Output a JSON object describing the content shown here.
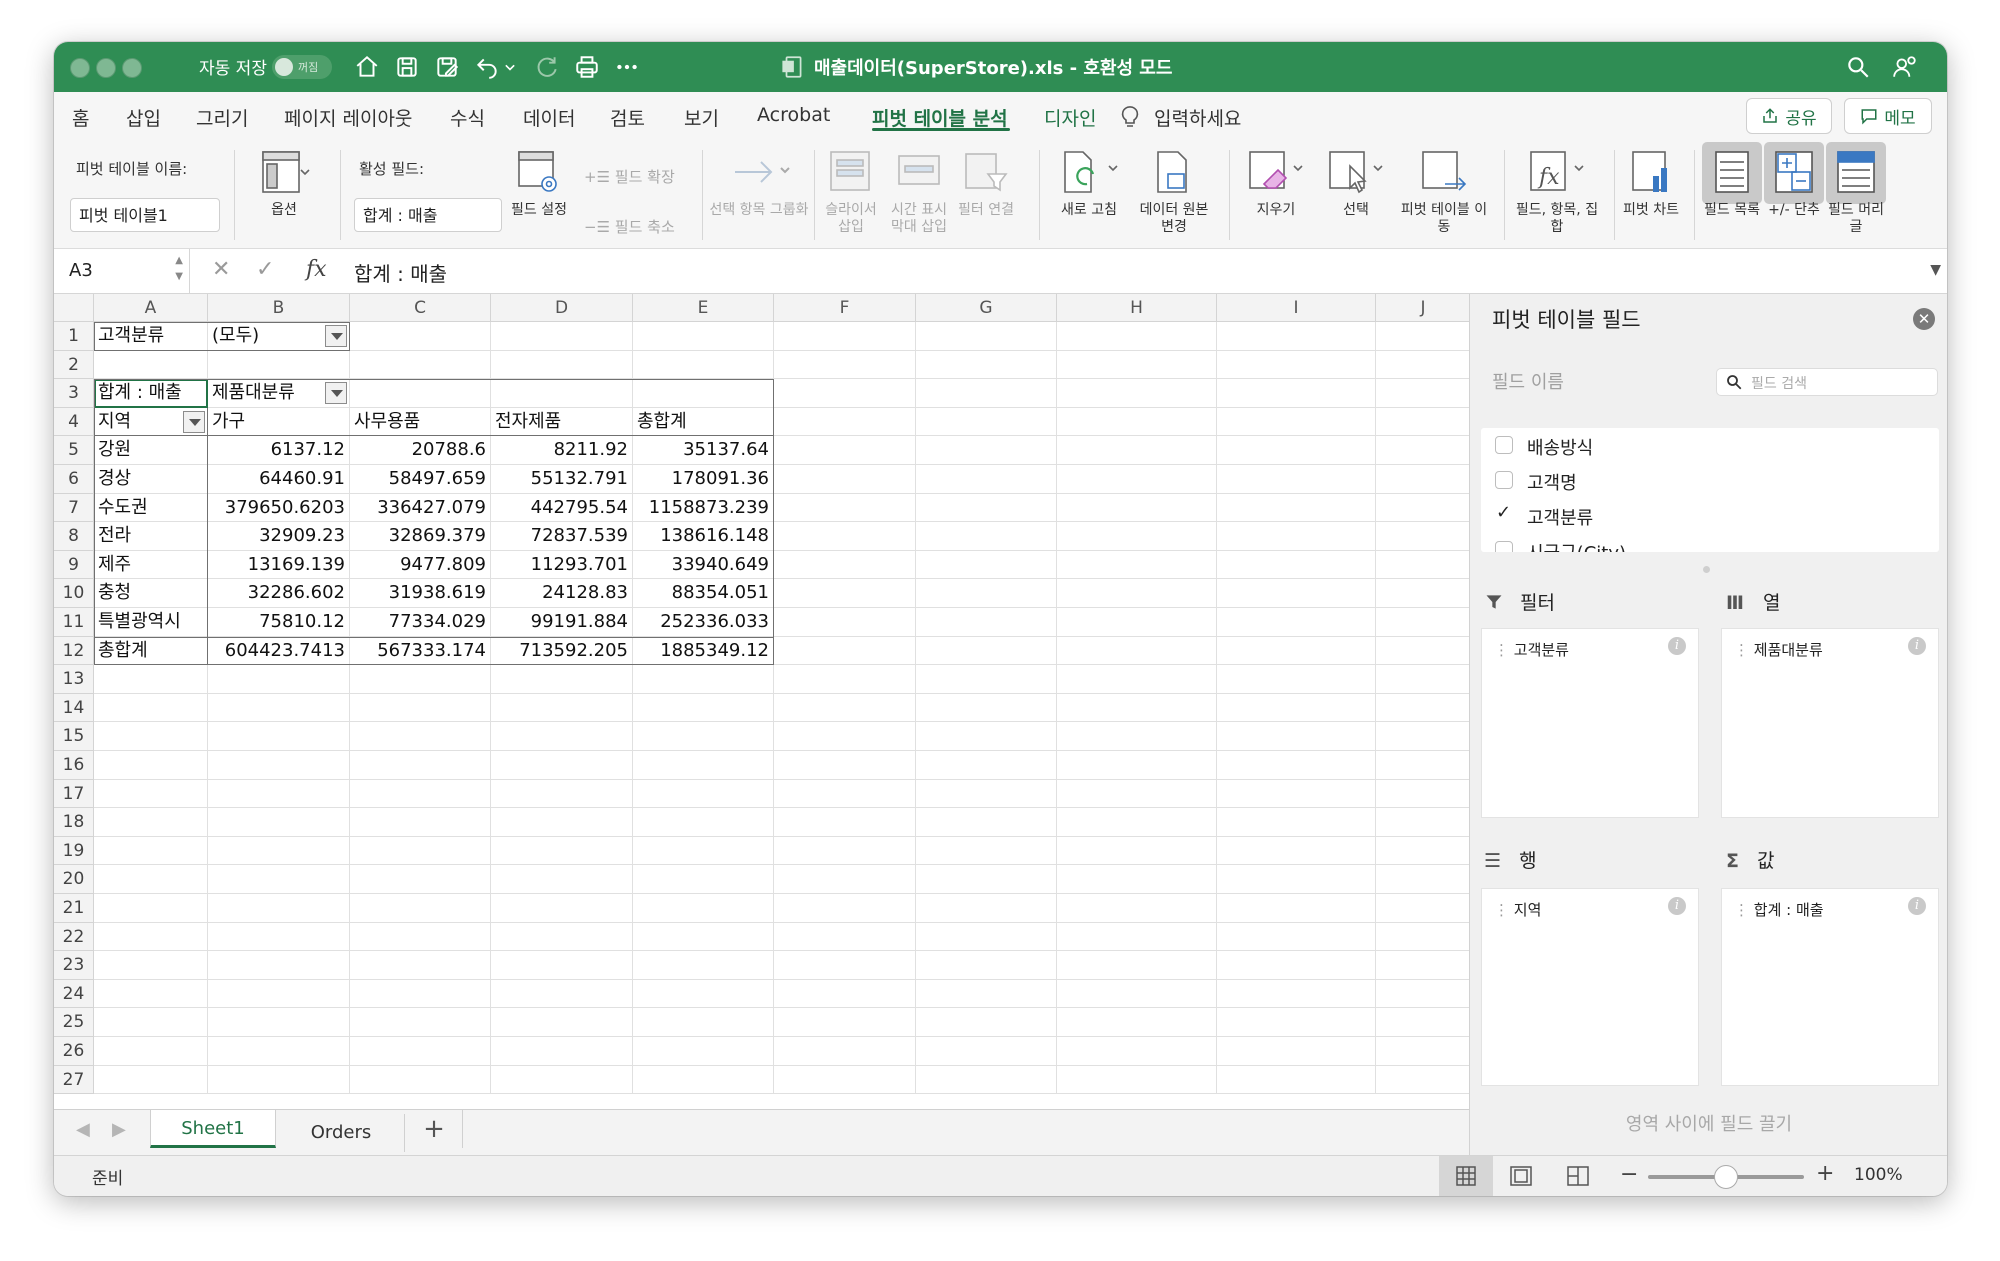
{
  "titlebar": {
    "autosave_label": "자동 저장",
    "autosave_state": "꺼짐",
    "document_title": "매출데이터(SuperStore).xls  -  호환성 모드"
  },
  "menu": {
    "tabs": [
      "홈",
      "삽입",
      "그리기",
      "페이지 레이아웃",
      "수식",
      "데이터",
      "검토",
      "보기",
      "Acrobat",
      "피벗 테이블 분석",
      "디자인"
    ],
    "active_tab": "피벗 테이블 분석",
    "tell_me": "입력하세요",
    "share_label": "공유",
    "comment_label": "메모",
    "accent_color": "#217346",
    "title_color": "#2f8d54"
  },
  "ribbon": {
    "pivot_name_label": "피벗 테이블 이름:",
    "pivot_name_value": "피벗 테이블1",
    "options_label": "옵션",
    "active_field_label": "활성 필드:",
    "active_field_value": "합계 : 매출",
    "field_settings_label": "필드 설정",
    "expand_field_label": "필드 확장",
    "collapse_field_label": "필드 축소",
    "group_selection_label": "선택 항목 그룹화",
    "insert_slicer_label": "슬라이서 삽입",
    "insert_timeline_label": "시간 표시 막대 삽입",
    "filter_connections_label": "필터 연결",
    "refresh_label": "새로 고침",
    "change_source_label": "데이터 원본 변경",
    "clear_label": "지우기",
    "select_label": "선택",
    "move_pivot_label": "피벗 테이블 이동",
    "fields_items_sets_label": "필드, 항목, 집합",
    "pivot_chart_label": "피벗 차트",
    "field_list_label": "필드 목록",
    "buttons_label": "+/- 단추",
    "field_headers_label": "필드 머리글"
  },
  "formula_bar": {
    "cell_ref": "A3",
    "formula": "합계 : 매출"
  },
  "sheet": {
    "columns": [
      "A",
      "B",
      "C",
      "D",
      "E",
      "F",
      "G",
      "H",
      "I",
      "J"
    ],
    "row_count": 27,
    "filter_label": "고객분류",
    "filter_value": "(모두)",
    "value_label": "합계 : 매출",
    "col_field_label": "제품대분류",
    "row_field_label": "지역",
    "col_headers": [
      "가구",
      "사무용품",
      "전자제품",
      "총합계"
    ],
    "rows": [
      {
        "label": "강원",
        "values": [
          "6137.12",
          "20788.6",
          "8211.92",
          "35137.64"
        ]
      },
      {
        "label": "경상",
        "values": [
          "64460.91",
          "58497.659",
          "55132.791",
          "178091.36"
        ]
      },
      {
        "label": "수도권",
        "values": [
          "379650.6203",
          "336427.079",
          "442795.54",
          "1158873.239"
        ]
      },
      {
        "label": "전라",
        "values": [
          "32909.23",
          "32869.379",
          "72837.539",
          "138616.148"
        ]
      },
      {
        "label": "제주",
        "values": [
          "13169.139",
          "9477.809",
          "11293.701",
          "33940.649"
        ]
      },
      {
        "label": "충청",
        "values": [
          "32286.602",
          "31938.619",
          "24128.83",
          "88354.051"
        ]
      },
      {
        "label": "특별광역시",
        "values": [
          "75810.12",
          "77334.029",
          "99191.884",
          "252336.033"
        ]
      },
      {
        "label": "총합계",
        "values": [
          "604423.7413",
          "567333.174",
          "713592.205",
          "1885349.12"
        ]
      }
    ]
  },
  "sheet_tabs": {
    "tabs": [
      "Sheet1",
      "Orders"
    ],
    "active": "Sheet1",
    "add_label": "+"
  },
  "status": {
    "ready": "준비",
    "zoom": "100%"
  },
  "pivot_pane": {
    "title": "피벗 테이블 필드",
    "field_name_label": "필드 이름",
    "search_placeholder": "필드 검색",
    "fields": [
      {
        "name": "배송방식",
        "checked": false
      },
      {
        "name": "고객명",
        "checked": false
      },
      {
        "name": "고객분류",
        "checked": true
      },
      {
        "name": "시군구(City)",
        "checked": false
      }
    ],
    "filters_label": "필터",
    "columns_label": "열",
    "rows_label": "행",
    "values_label": "값",
    "filter_item": "고객분류",
    "column_item": "제품대분류",
    "row_item": "지역",
    "value_item": "합계 : 매출",
    "drag_hint": "영역 사이에 필드 끌기"
  }
}
